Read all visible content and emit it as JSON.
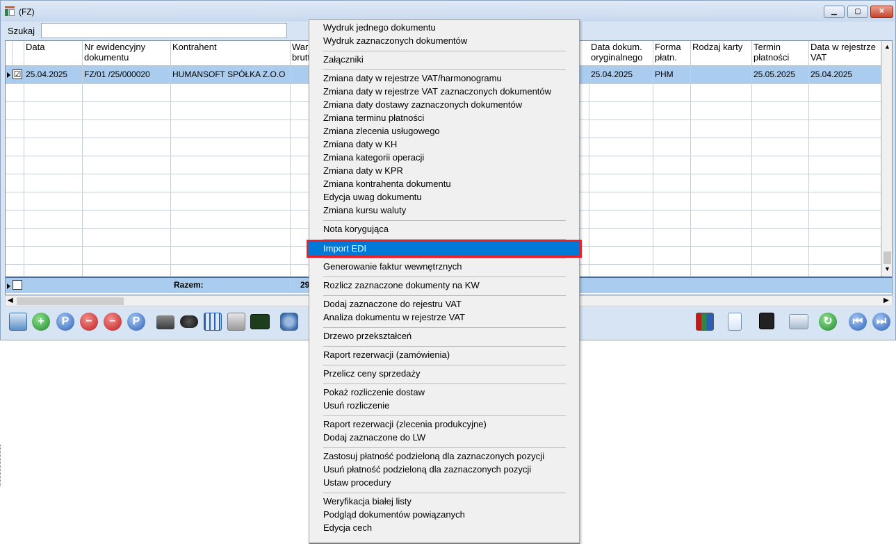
{
  "window": {
    "title": "(FZ)",
    "minimize_glyph": "▁",
    "maximize_glyph": "▢",
    "close_glyph": "✕"
  },
  "search": {
    "label": "Szukaj",
    "value": "",
    "placeholder": ""
  },
  "columns": {
    "data": "Data",
    "nr_line1": "Nr ewidencyjny",
    "nr_line2": "dokumentu",
    "kontrahent": "Kontrahent",
    "wartosc_line1": "War",
    "wartosc_line2": "brutt",
    "data_dokum_line1": "Data dokum.",
    "data_dokum_line2": "oryginalnego",
    "forma_line1": "Forma",
    "forma_line2": "płatn.",
    "rodzaj": "Rodzaj karty",
    "termin_line1": "Termin",
    "termin_line2": "płatności",
    "data_rej_line1": "Data w rejestrze",
    "data_rej_line2": "VAT"
  },
  "row1": {
    "checked": "☑",
    "data": "25.04.2025",
    "nr": "FZ/01 /25/000020",
    "kontrahent": "HUMANSOFT SPÓŁKA Z.O.O",
    "data_dokum": "25.04.2025",
    "forma": "PHM",
    "rodzaj": "",
    "termin": "25.05.2025",
    "data_rej": "25.04.2025"
  },
  "footer": {
    "label": "Razem:",
    "value_partial": "29"
  },
  "toolbar_icons": {
    "left": [
      "document-export-icon",
      "add-icon",
      "preview-icon",
      "delete-icon",
      "delete-checked-icon",
      "p-icon",
      "print-icon",
      "binoculars-icon",
      "table-icon",
      "recycle-icon",
      "formula-icon",
      "structure-icon"
    ],
    "right": [
      "chart-icon",
      "report-icon",
      "save-icon",
      "windows-icon",
      "refresh-icon",
      "first-icon",
      "last-icon"
    ]
  },
  "context_menu": {
    "items": [
      "Wydruk jednego dokumentu",
      "Wydruk zaznaczonych dokumentów",
      "Załączniki",
      "Zmiana daty w rejestrze VAT/harmonogramu",
      "Zmiana daty w rejestrze VAT zaznaczonych dokumentów",
      "Zmiana daty dostawy zaznaczonych dokumentów",
      "Zmiana terminu płatności",
      "Zmiana zlecenia usługowego",
      "Zmiana daty w KH",
      "Zmiana kategorii operacji",
      "Zmiana daty w KPR",
      "Zmiana kontrahenta dokumentu",
      "Edycja uwag dokumentu",
      "Zmiana kursu waluty",
      "Nota korygująca",
      "Import EDI",
      "Generowanie faktur wewnętrznych",
      "Rozlicz zaznaczone dokumenty na KW",
      "Dodaj zaznaczone do rejestru VAT",
      "Analiza dokumentu w rejestrze VAT",
      "Drzewo przekształceń",
      "Raport rezerwacji (zamówienia)",
      "Przelicz ceny sprzedaży",
      "Pokaż rozliczenie dostaw",
      "Usuń rozliczenie",
      "Raport rezerwacji (zlecenia produkcyjne)",
      "Dodaj zaznaczone do LW",
      "Zastosuj płatność podzieloną dla zaznaczonych pozycji",
      "Usuń płatność podzieloną dla zaznaczonych pozycji",
      "Ustaw procedury",
      "Weryfikacja białej listy",
      "Podgląd dokumentów powiązanych",
      "Edycja cech"
    ],
    "highlighted": "Import EDI",
    "highlight_color": "#0078d7",
    "outline_color": "#e8202a"
  }
}
